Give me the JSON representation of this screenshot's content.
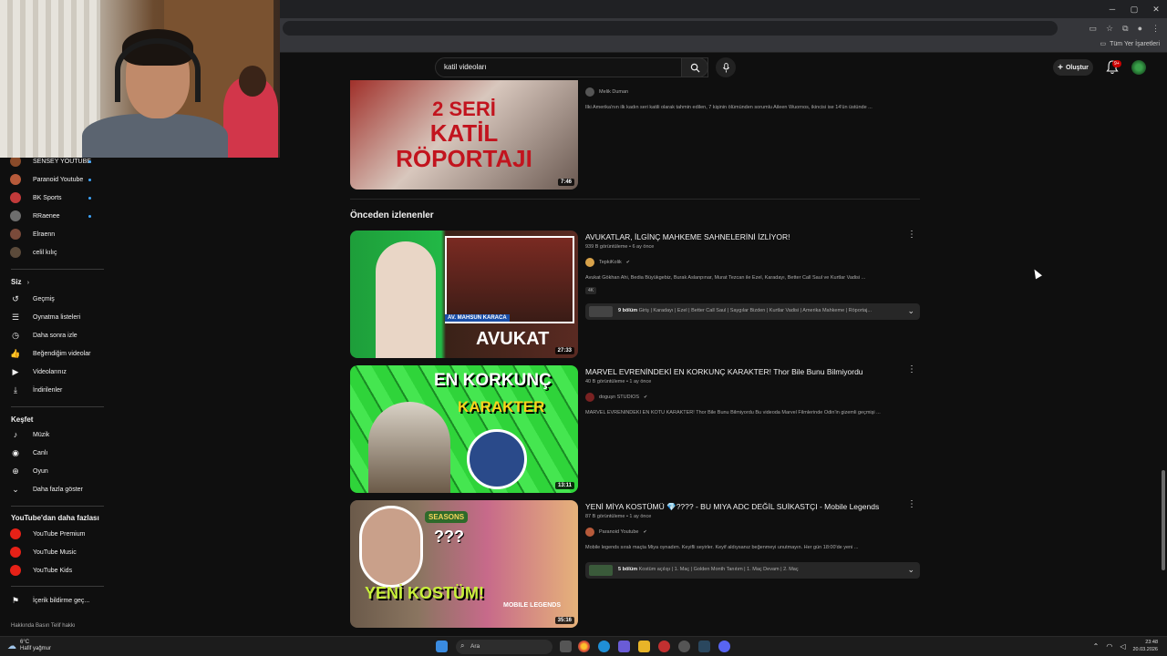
{
  "header": {
    "search_value": "katil videoları",
    "create_label": "Oluştur",
    "notif_count": "9+"
  },
  "bookmarks": {
    "label": "Tüm Yer İşaretleri"
  },
  "sidebar": {
    "subs": [
      {
        "label": "SENSEY YOUTUBE",
        "color": "#8a4b2a"
      },
      {
        "label": "Paranoid Youtube",
        "color": "#b75a3a"
      },
      {
        "label": "BK Sports",
        "color": "#c23a3a"
      },
      {
        "label": "RRaenee",
        "color": "#6d6d6d"
      },
      {
        "label": "Elraenn",
        "color": "#7a4a3a"
      },
      {
        "label": "celil kılıç",
        "color": "#5b4a3a"
      }
    ],
    "you_heading": "Siz",
    "you_items": [
      {
        "label": "Geçmiş",
        "icon": "history-icon"
      },
      {
        "label": "Oynatma listeleri",
        "icon": "playlist-icon"
      },
      {
        "label": "Daha sonra izle",
        "icon": "clock-icon"
      },
      {
        "label": "Beğendiğim videolar",
        "icon": "like-icon"
      },
      {
        "label": "Videolarınız",
        "icon": "video-icon"
      },
      {
        "label": "İndirilenler",
        "icon": "download-icon"
      }
    ],
    "explore_heading": "Keşfet",
    "explore_items": [
      {
        "label": "Müzik",
        "icon": "music-icon"
      },
      {
        "label": "Canlı",
        "icon": "live-icon"
      },
      {
        "label": "Oyun",
        "icon": "gaming-icon"
      },
      {
        "label": "Daha fazla göster",
        "icon": "chevron-down-icon"
      }
    ],
    "more_heading": "YouTube'dan daha fazlası",
    "more_items": [
      {
        "label": "YouTube Premium"
      },
      {
        "label": "YouTube Music"
      },
      {
        "label": "YouTube Kids"
      }
    ],
    "report_label": "İçerik bildirme geç...",
    "footer": "Hakkında  Basın  Telif hakkı"
  },
  "results": {
    "top_video": {
      "channel": "Melik Duman",
      "desc": "İlki Amerika'nın ilk kadın seri katili olarak tahmin edilen, 7 kişinin ölümünden sorumlu Aileen Wuornos, ikincisi ise 14'ün üstünde ...",
      "duration": "7:46",
      "thumb_lines": [
        "2 SERİ",
        "KATİL",
        "RÖPORTAJI"
      ]
    },
    "section_title": "Önceden izlenenler",
    "videos": [
      {
        "title": "AVUKATLAR, İLGİNÇ MAHKEME SAHNELERİNİ İZLİYOR!",
        "meta": "939 B görüntüleme • 6 ay önce",
        "channel": "TepkiKolik",
        "desc": "Avukat Gökhan Ahi, Bedia Büyükgebiz, Burak Aslanpınar, Murat Tezcan ile Ezel, Karadayı, Better Call Saul ve Kurtlar Vadisi ...",
        "badge": "4K",
        "chapters_count": "9 bölüm",
        "chapters_text": "Giriş | Karadayı | Ezel | Better Call Saul | Saygılar Bizden | Kurtlar Vadisi | Amerika Mahkeme | Röportaj...",
        "duration": "27:33",
        "thumb_caption": "AVUKAT",
        "thumb_tag": "AV. MAHSUN KARACA"
      },
      {
        "title": "MARVEL EVRENİNDEKİ EN KORKUNÇ KARAKTER! Thor Bile Bunu Bilmiyordu",
        "meta": "40 B görüntüleme • 1 ay önce",
        "channel": "doguşn STUDIOS",
        "desc": "MARVEL EVRENİNDEKİ EN KÖTÜ KARAKTER! Thor Bile Bunu Bilmiyordu Bu videoda Marvel Filmlerinde Odin'in gizemli geçmişi ...",
        "duration": "13:11",
        "thumb_lines": [
          "EN KORKUNÇ",
          "KARAKTER"
        ]
      },
      {
        "title": "YENİ MİYA KOSTÜMÜ 💎???? - BU MIYA ADC DEĞİL SUİKASTÇI - Mobile Legends",
        "meta": "87 B görüntüleme • 1 ay önce",
        "channel": "Paranoid Youtube",
        "desc": "Mobile legends sıralı maçta Miya oynadım. Keyifli seyirler. Keyif aldıysanız beğenmeyi unutmayın. Her gün 18:00'de yeni ...",
        "chapters_count": "5 bölüm",
        "chapters_text": "Kostüm açılışı | 1. Maç | Golden Month Tanıtım | 1. Maç Devam | 2. Maç",
        "duration": "35:16",
        "thumb_caption": "YENİ KOSTÜM!",
        "thumb_tag": "SEASONS",
        "thumb_q": "???",
        "thumb_logo": "MOBILE LEGENDS"
      }
    ]
  },
  "taskbar": {
    "temp": "6°C",
    "weather": "Hafif yağmur",
    "search_label": "Ara",
    "time": "23:48",
    "date": "20.03.2026"
  }
}
